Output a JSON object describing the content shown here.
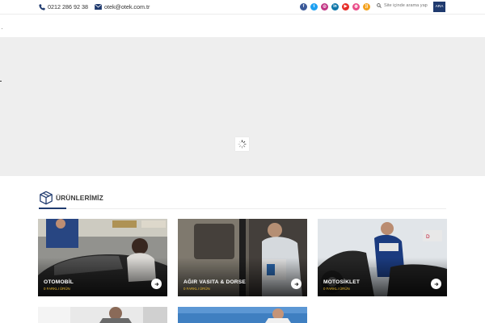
{
  "topbar": {
    "phone": "0212 286 92 38",
    "email": "otek@otek.com.tr",
    "socials": [
      {
        "icon": "facebook-icon",
        "color": "#3b5998",
        "glyph": "f"
      },
      {
        "icon": "twitter-icon",
        "color": "#1da1f2",
        "glyph": "t"
      },
      {
        "icon": "instagram-icon",
        "color": "#c13584",
        "glyph": "◎"
      },
      {
        "icon": "linkedin-icon",
        "color": "#0e76a8",
        "glyph": "in"
      },
      {
        "icon": "youtube-icon",
        "color": "#e52d27",
        "glyph": "▶"
      },
      {
        "icon": "dribbble-icon",
        "color": "#ea4c89",
        "glyph": "◍"
      },
      {
        "icon": "rss-icon",
        "color": "#f4a21d",
        "glyph": "))"
      }
    ],
    "search_placeholder": "Site içinde arama yap",
    "search_button": "ARA"
  },
  "products": {
    "title": "ÜRÜNLERİMİZ",
    "cards": [
      {
        "title": "OTOMOBİL",
        "subtitle": "0 FARKLI ÜRÜN"
      },
      {
        "title": "AĞIR VASITA & DORSE",
        "subtitle": "0 FARKLI ÜRÜN"
      },
      {
        "title": "MOTOSİKLET",
        "subtitle": "0 FARKLI ÜRÜN"
      }
    ]
  },
  "colors": {
    "brand": "#1f3a6e",
    "accent": "#e8b931"
  }
}
